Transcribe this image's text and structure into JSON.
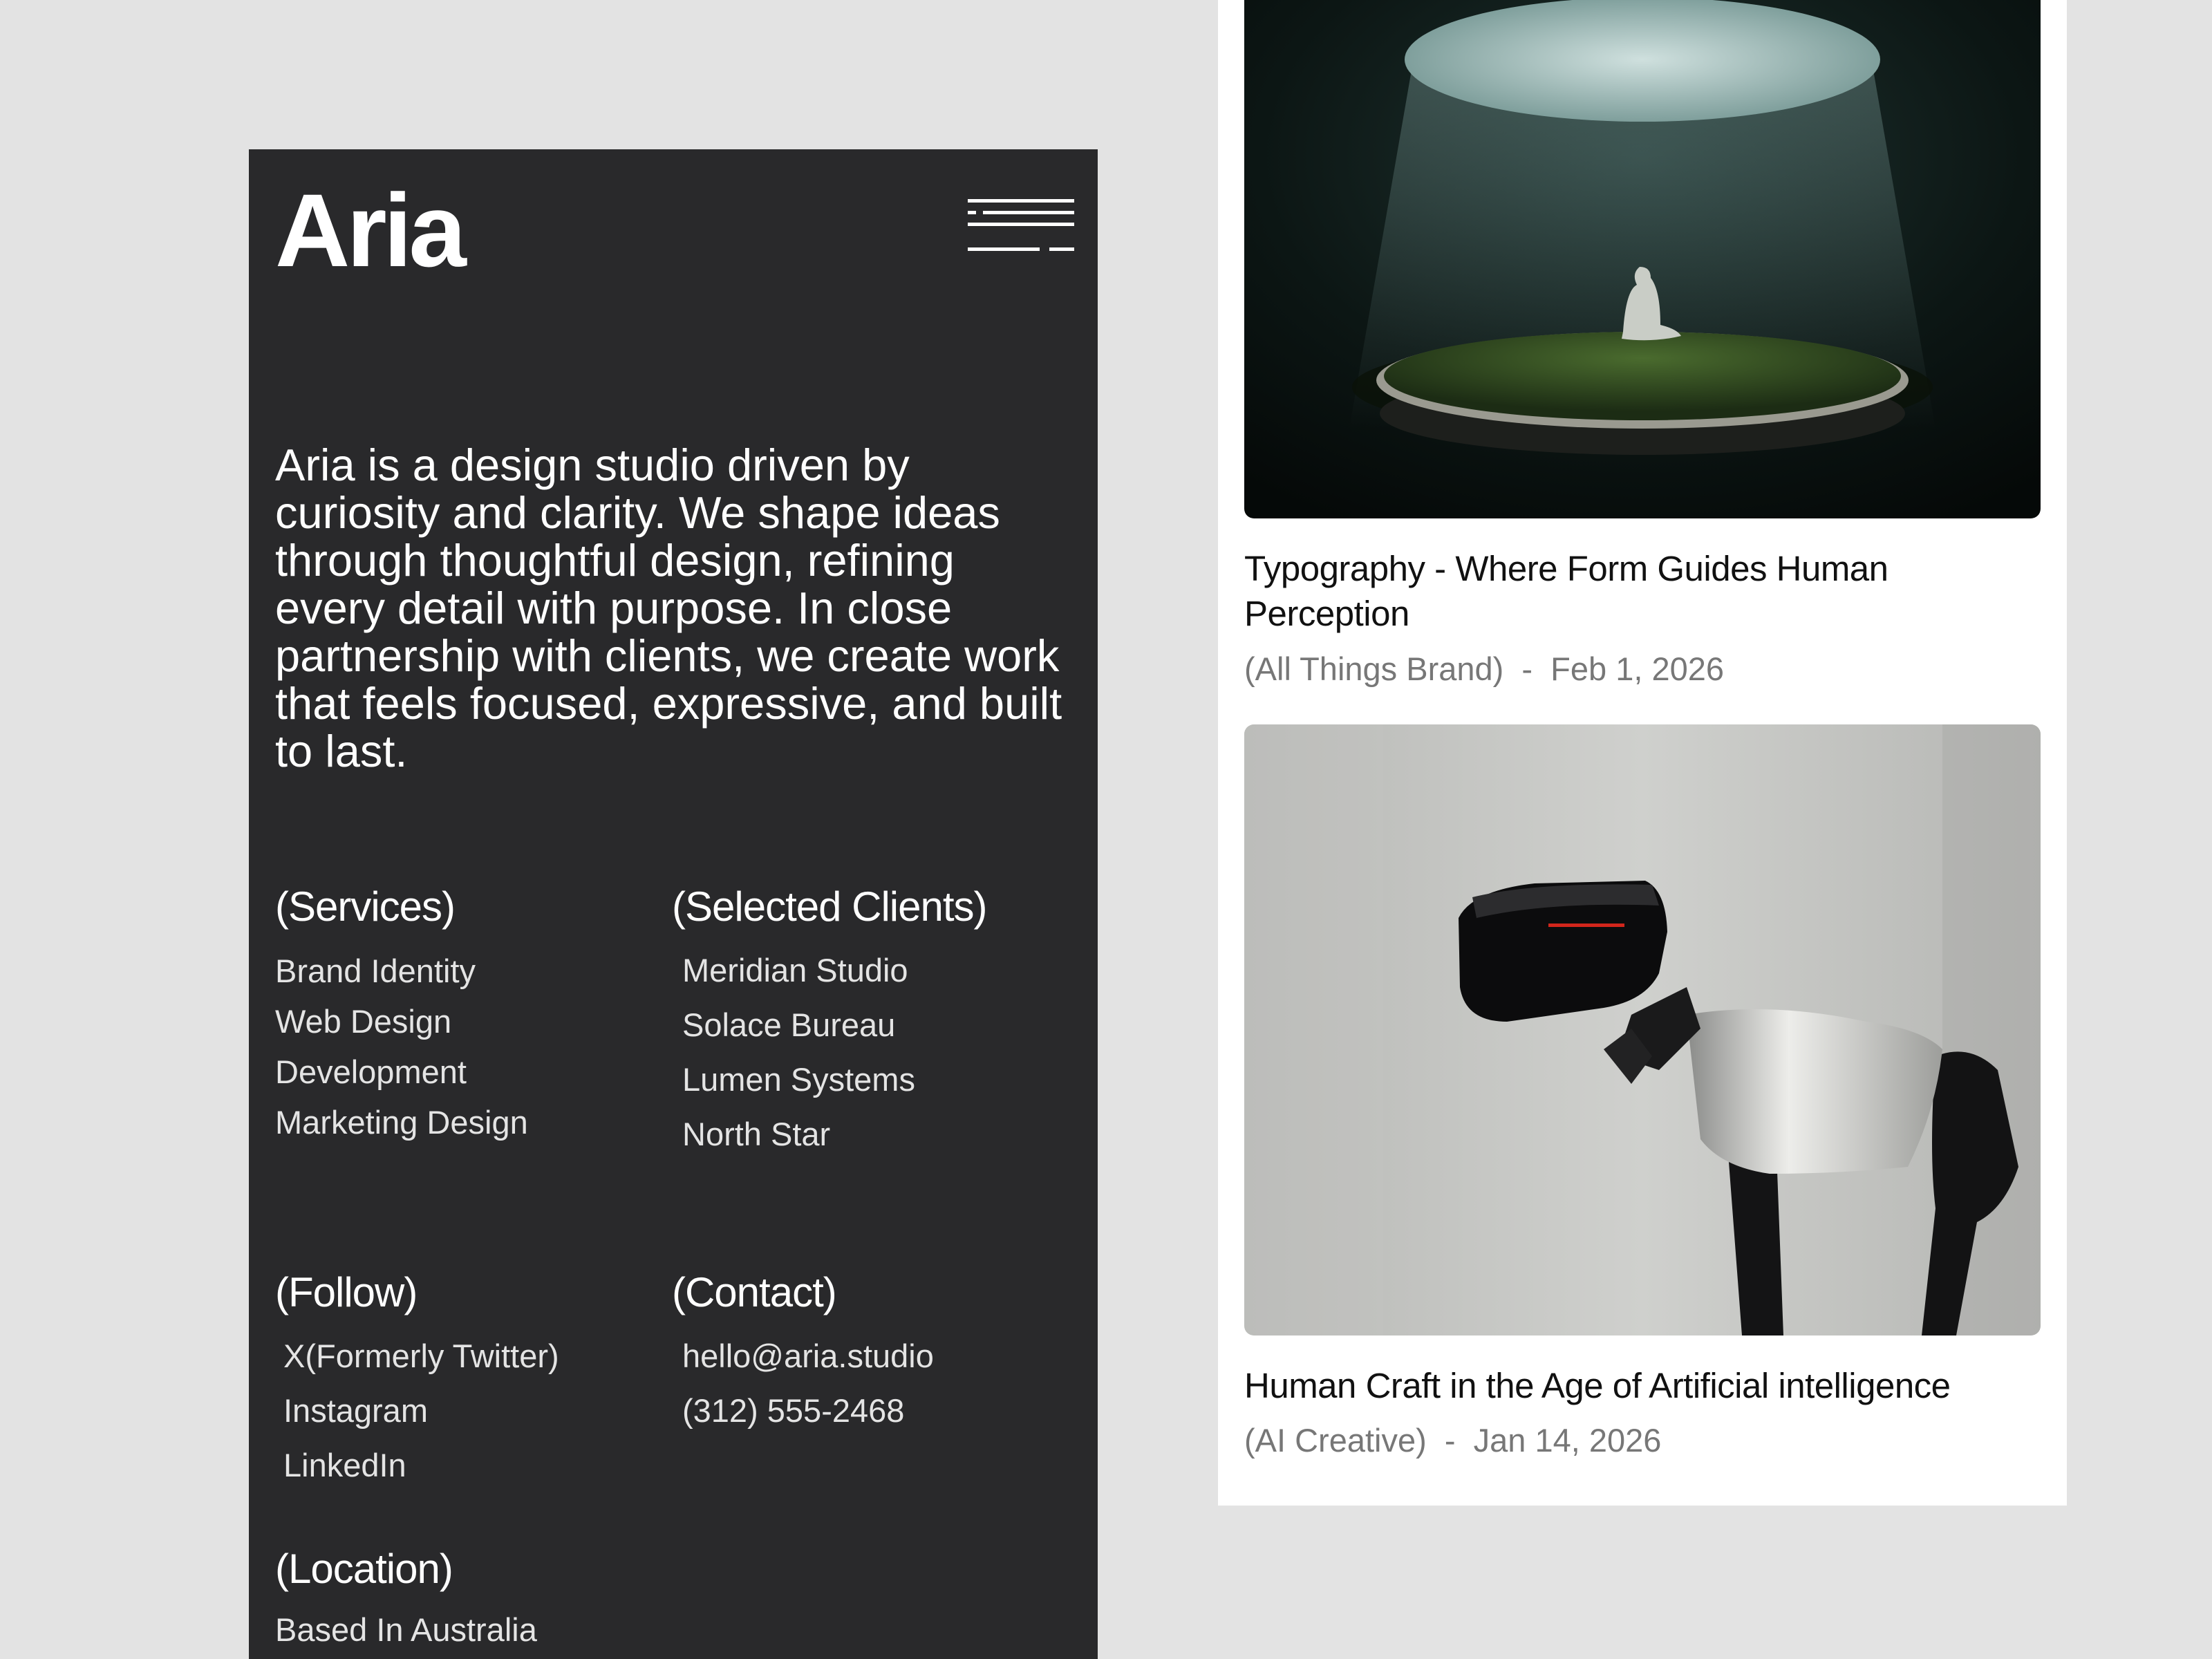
{
  "brand": {
    "logo_text": "Aria",
    "menu_icon": "hamburger-menu-icon"
  },
  "intro": {
    "text": "Aria is a design studio driven by curiosity and clarity. We shape ideas through thoughtful design, refining every detail with purpose. In close partnership with clients, we create work that feels focused, expressive, and built to last."
  },
  "services": {
    "title": "(Services)",
    "items": [
      "Brand Identity",
      "Web Design",
      "Development",
      "Marketing Design"
    ]
  },
  "clients": {
    "title": "(Selected Clients)",
    "items": [
      "Meridian Studio",
      "Solace Bureau",
      "Lumen Systems",
      "North Star"
    ]
  },
  "follow": {
    "title": "(Follow)",
    "items": [
      "X(Formerly Twitter)",
      "Instagram",
      "LinkedIn"
    ]
  },
  "contact": {
    "title": "(Contact)",
    "email": "hello@aria.studio",
    "phone": "(312) 555-2468"
  },
  "location": {
    "title": "(Location)",
    "text": "Based In Australia"
  },
  "articles": [
    {
      "title": "Typography - Where Form Guides Human Perception",
      "category": "(All Things Brand)",
      "date": "Feb 1, 2026",
      "meta": "(All Things Brand)  -  Feb 1, 2026"
    },
    {
      "title": "Human Craft in the Age of Artificial intelligence",
      "category": "(AI Creative)",
      "date": "Jan 14, 2026",
      "meta": "(AI Creative)  -  Jan 14, 2026"
    }
  ],
  "colors": {
    "background": "#e3e3e3",
    "panel": "#29292b",
    "card": "#ffffff",
    "meta_text": "#777777"
  }
}
